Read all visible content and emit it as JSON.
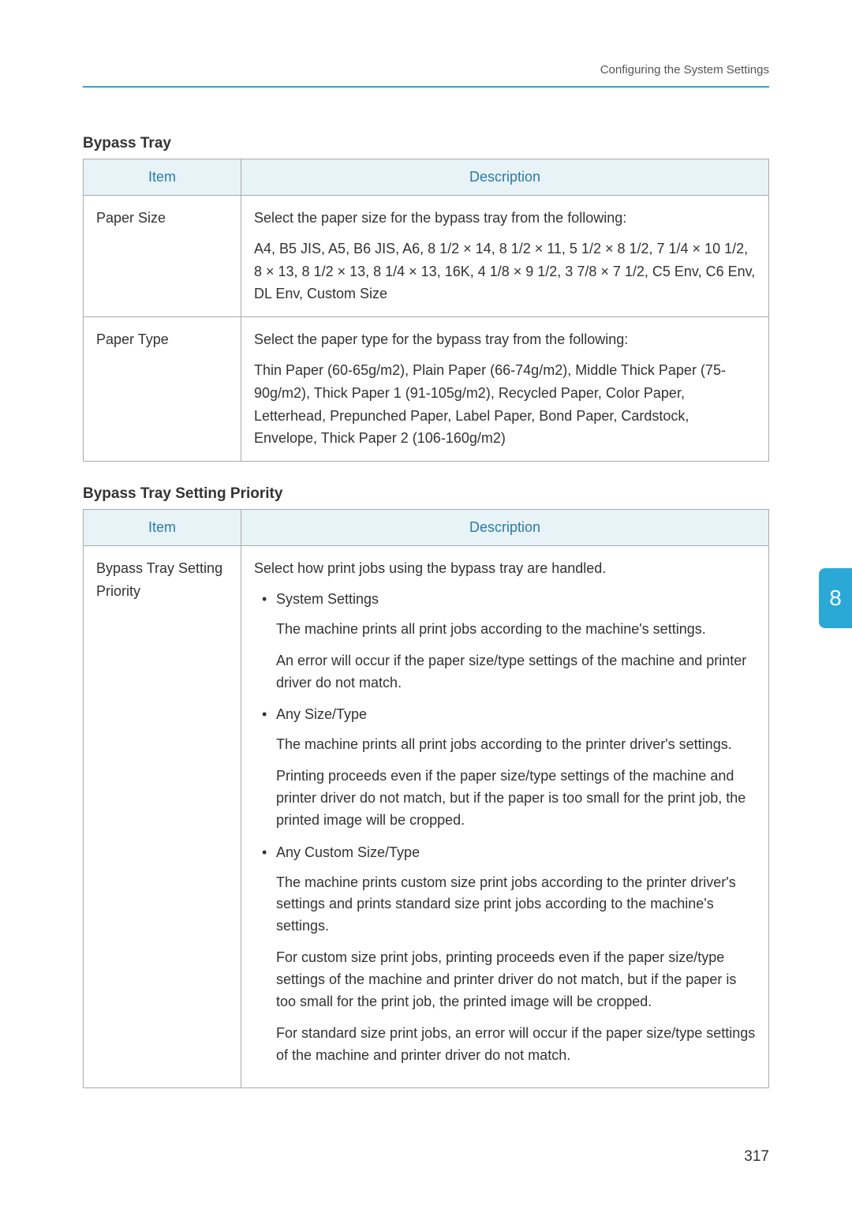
{
  "header": {
    "breadcrumb": "Configuring the System Settings"
  },
  "section1": {
    "title": "Bypass Tray",
    "columns": {
      "item": "Item",
      "description": "Description"
    },
    "rows": [
      {
        "item": "Paper Size",
        "para1": "Select the paper size for the bypass tray from the following:",
        "para2": "A4, B5 JIS, A5, B6 JIS, A6, 8 1/2 × 14, 8 1/2 × 11, 5 1/2 × 8 1/2, 7 1/4 × 10 1/2, 8 × 13, 8 1/2 × 13, 8 1/4 × 13, 16K, 4 1/8 × 9 1/2, 3 7/8 × 7 1/2, C5 Env, C6 Env, DL Env, Custom Size"
      },
      {
        "item": "Paper Type",
        "para1": "Select the paper type for the bypass tray from the following:",
        "para2": "Thin Paper (60-65g/m2), Plain Paper (66-74g/m2), Middle Thick Paper (75-90g/m2), Thick Paper 1 (91-105g/m2), Recycled Paper, Color Paper, Letterhead, Prepunched Paper, Label Paper, Bond Paper, Cardstock, Envelope, Thick Paper 2 (106-160g/m2)"
      }
    ]
  },
  "section2": {
    "title": "Bypass Tray Setting Priority",
    "columns": {
      "item": "Item",
      "description": "Description"
    },
    "row": {
      "item": "Bypass Tray Setting Priority",
      "intro": "Select how print jobs using the bypass tray are handled.",
      "bullet1": "System Settings",
      "b1_sub1": "The machine prints all print jobs according to the machine's settings.",
      "b1_sub2": "An error will occur if the paper size/type settings of the machine and printer driver do not match.",
      "bullet2": "Any Size/Type",
      "b2_sub1": "The machine prints all print jobs according to the printer driver's settings.",
      "b2_sub2": "Printing proceeds even if the paper size/type settings of the machine and printer driver do not match, but if the paper is too small for the print job, the printed image will be cropped.",
      "bullet3": "Any Custom Size/Type",
      "b3_sub1": "The machine prints custom size print jobs according to the printer driver's settings and prints standard size print jobs according to the machine's settings.",
      "b3_sub2": "For custom size print jobs, printing proceeds even if the paper size/type settings of the machine and printer driver do not match, but if the paper is too small for the print job, the printed image will be cropped.",
      "b3_sub3": "For standard size print jobs, an error will occur if the paper size/type settings of the machine and printer driver do not match."
    }
  },
  "pageTab": "8",
  "pageNumber": "317"
}
